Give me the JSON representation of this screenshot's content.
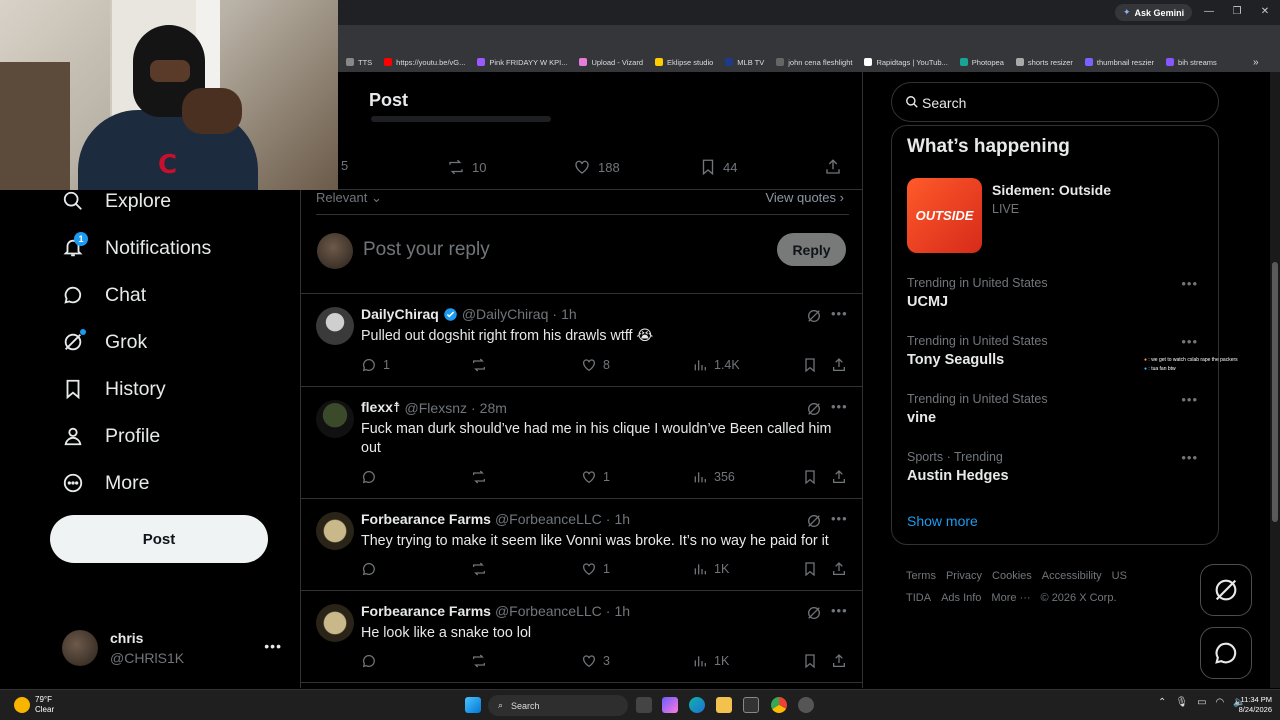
{
  "browser": {
    "ask_gemini": "Ask Gemini",
    "bookmarks": [
      "TTS",
      "https://youtu.be/vG...",
      "Pink FRIDAYY W KPI...",
      "Upload - Vizard",
      "Eklipse studio",
      "MLB TV",
      "john cena fleshlight",
      "Rapidtags | YouTub...",
      "Photopea",
      "shorts resizer",
      "thumbnail reszier",
      "bih streams"
    ],
    "bookmark_colors": [
      "#888888",
      "#ff0000",
      "#9b59ff",
      "#e67dd9",
      "#ffcc00",
      "#1e3a8a",
      "#666666",
      "#ffffff",
      "#18a497",
      "#aaaaaa",
      "#7b61ff",
      "#8855ff"
    ]
  },
  "sidebar": {
    "items": [
      {
        "label": "Explore",
        "icon": "search-icon"
      },
      {
        "label": "Notifications",
        "icon": "bell-icon",
        "badge": "1"
      },
      {
        "label": "Chat",
        "icon": "chat-icon"
      },
      {
        "label": "Grok",
        "icon": "grok-icon"
      },
      {
        "label": "History",
        "icon": "bookmark-icon"
      },
      {
        "label": "Profile",
        "icon": "person-icon"
      },
      {
        "label": "More",
        "icon": "more-circle-icon"
      }
    ],
    "post_label": "Post",
    "account": {
      "name": "chris",
      "handle": "@CHRlS1K"
    }
  },
  "post": {
    "header": "Post",
    "stats": {
      "replies": "5",
      "reposts": "10",
      "likes": "188",
      "bookmarks": "44"
    },
    "sort_label": "Relevant",
    "view_quotes": "View quotes",
    "reply_placeholder": "Post your reply",
    "reply_button": "Reply"
  },
  "replies": [
    {
      "name": "DailyChiraq",
      "verified": true,
      "handle": "@DailyChiraq",
      "time": "1h",
      "text": "Pulled out dogshit right from his drawls wtff 😭",
      "replies": "1",
      "reposts": "",
      "likes": "8",
      "views": "1.4K"
    },
    {
      "name": "flexx☨",
      "verified": false,
      "handle": "@Flexsnz",
      "time": "28m",
      "text": "Fuck man durk should’ve had me in his clique I wouldn’ve Been called him out",
      "replies": "",
      "reposts": "",
      "likes": "1",
      "views": "356"
    },
    {
      "name": "Forbearance Farms",
      "verified": false,
      "handle": "@ForbeanceLLC",
      "time": "1h",
      "text": "They trying to make it seem like Vonni was broke. It’s no way he paid for it",
      "replies": "",
      "reposts": "",
      "likes": "1",
      "views": "1K"
    },
    {
      "name": "Forbearance Farms",
      "verified": false,
      "handle": "@ForbeanceLLC",
      "time": "1h",
      "text": "He look like a snake too lol",
      "replies": "",
      "reposts": "",
      "likes": "3",
      "views": "1K"
    }
  ],
  "right": {
    "search_placeholder": "Search",
    "happening_title": "What’s happening",
    "live": {
      "title": "Sidemen: Outside",
      "status": "LIVE",
      "thumb_text": "OUTSIDE"
    },
    "trends": [
      {
        "context": "Trending in United States",
        "title": "UCMJ"
      },
      {
        "context": "Trending in United States",
        "title": "Tony Seagulls"
      },
      {
        "context": "Trending in United States",
        "title": "vine"
      },
      {
        "context": "Sports · Trending",
        "title": "Austin Hedges"
      }
    ],
    "show_more": "Show more",
    "footer": [
      "Terms",
      "Privacy",
      "Cookies",
      "Accessibility",
      "US TIDA",
      "Ads Info",
      "More ···",
      "© 2026 X Corp."
    ]
  },
  "chat_overlay": [
    ": we get to watch cslab rape the packers",
    ": tua fan btw"
  ],
  "taskbar": {
    "weather_temp": "79°F",
    "weather_desc": "Clear",
    "search_label": "Search",
    "time": "11:34 PM",
    "date": "8/24/2026"
  },
  "colors": {
    "accent": "#1d9bf0",
    "verified": "#1d9bf0",
    "badge": "#1d9bf0"
  }
}
